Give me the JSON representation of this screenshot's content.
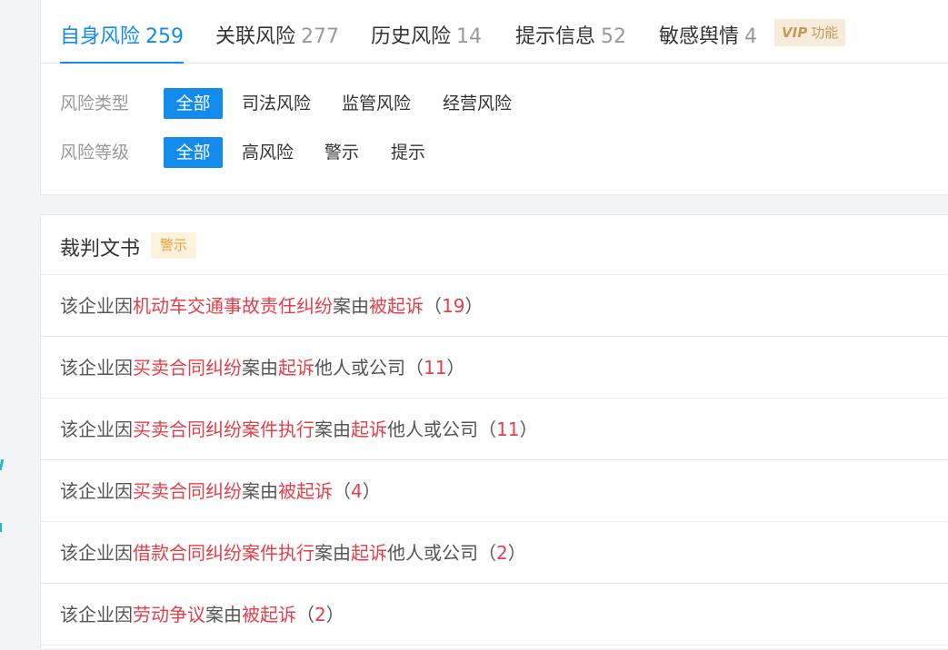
{
  "tabs": [
    {
      "label": "自身风险",
      "count": "259",
      "active": true
    },
    {
      "label": "关联风险",
      "count": "277",
      "active": false
    },
    {
      "label": "历史风险",
      "count": "14",
      "active": false
    },
    {
      "label": "提示信息",
      "count": "52",
      "active": false
    },
    {
      "label": "敏感舆情",
      "count": "4",
      "active": false
    }
  ],
  "vip_badge": {
    "vip": "VIP",
    "text": "功能"
  },
  "filters": {
    "type": {
      "label": "风险类型",
      "options": [
        "全部",
        "司法风险",
        "监管风险",
        "经营风险"
      ],
      "selected": "全部"
    },
    "level": {
      "label": "风险等级",
      "options": [
        "全部",
        "高风险",
        "警示",
        "提示"
      ],
      "selected": "全部"
    }
  },
  "section": {
    "title": "裁判文书",
    "tag": "警示"
  },
  "risks": [
    {
      "prefix": "该企业因",
      "reason": "机动车交通事故责任纠纷",
      "mid": "案由",
      "action": "被起诉",
      "suffix": "",
      "open": "（",
      "count": "19",
      "close": "）"
    },
    {
      "prefix": "该企业因",
      "reason": "买卖合同纠纷",
      "mid": "案由",
      "action": "起诉",
      "suffix": "他人或公司",
      "open": "（",
      "count": "11",
      "close": "）"
    },
    {
      "prefix": "该企业因",
      "reason": "买卖合同纠纷案件执行",
      "mid": "案由",
      "action": "起诉",
      "suffix": "他人或公司",
      "open": "（",
      "count": "11",
      "close": "）"
    },
    {
      "prefix": "该企业因",
      "reason": "买卖合同纠纷",
      "mid": "案由",
      "action": "被起诉",
      "suffix": "",
      "open": "（",
      "count": "4",
      "close": "）"
    },
    {
      "prefix": "该企业因",
      "reason": "借款合同纠纷案件执行",
      "mid": "案由",
      "action": "起诉",
      "suffix": "他人或公司",
      "open": "（",
      "count": "2",
      "close": "）"
    },
    {
      "prefix": "该企业因",
      "reason": "劳动争议",
      "mid": "案由",
      "action": "被起诉",
      "suffix": "",
      "open": "（",
      "count": "2",
      "close": "）"
    }
  ],
  "colors": {
    "accent": "#128bed",
    "highlight": "#e23f4b",
    "tag_bg": "#fdf2dc",
    "tag_text": "#e9a13b"
  }
}
